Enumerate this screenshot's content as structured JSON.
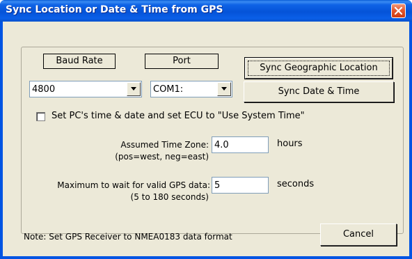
{
  "window": {
    "title": "Sync Location or Date & Time from GPS"
  },
  "baud": {
    "label": "Baud Rate",
    "value": "4800"
  },
  "port": {
    "label": "Port",
    "value": "COM1:"
  },
  "buttons": {
    "sync_location": "Sync Geographic Location",
    "sync_datetime": "Sync Date & Time",
    "cancel": "Cancel"
  },
  "checkbox": {
    "label": "Set PC's time & date and set ECU to \"Use System Time\"",
    "checked": false
  },
  "timezone": {
    "label": "Assumed Time Zone:",
    "hint": "(pos=west, neg=east)",
    "value": "4.0",
    "unit": "hours"
  },
  "maxwait": {
    "label": "Maximum to wait for valid GPS data:",
    "hint": "(5 to 180 seconds)",
    "value": "5",
    "unit": "seconds"
  },
  "note": "Note: Set GPS Receiver to NMEA0183 data format",
  "colors": {
    "titlebar": "#0054e3",
    "face": "#ece9d8",
    "close": "#e4582f"
  }
}
